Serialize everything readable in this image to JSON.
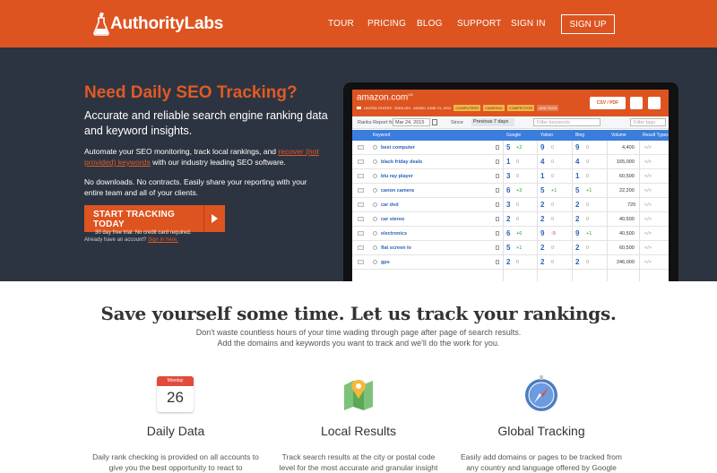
{
  "nav": {
    "logo_text": "AuthorityLabs",
    "links": [
      "TOUR",
      "PRICING",
      "BLOG",
      "SUPPORT",
      "SIGN IN"
    ],
    "signup": "SIGN UP"
  },
  "hero": {
    "title": "Need Daily SEO Tracking?",
    "subtitle": "Accurate and reliable search engine ranking data and keyword insights.",
    "p1_before": "Automate your SEO monitoring, track local rankings, and ",
    "p1_link": "recover (not provided) keywords",
    "p1_after": " with our industry leading SEO software.",
    "p2": "No downloads. No contracts. Easily share your reporting with your entire team and all of your clients.",
    "cta_main": "START TRACKING TODAY",
    "cta_small": "30 day free trial. No credit card required.",
    "already_text": "Already have an account? ",
    "already_link": "Sign in here."
  },
  "app": {
    "domain": "amazon.com",
    "domain_sup": "US",
    "meta": "UNITED STATES · ENGLISH",
    "added": "ADDED JUNE 21, 2012",
    "tags": [
      "COMPUTERS",
      "CAMERAS",
      "COMPETITOR",
      "ADD TAGS"
    ],
    "csv": "CSV / PDF",
    "ranks_label": "Ranks Report for",
    "date": "Mar 24, 2015",
    "since": "Since",
    "since_sel": "Previous 7 days",
    "filter_kw": "Filter keywords",
    "filter_tags": "Filter tags",
    "headers": [
      "Keyword",
      "Google",
      "Yahoo",
      "Bing",
      "Volume",
      "Result Types"
    ],
    "rows": [
      {
        "kw": "best computer",
        "g": "5",
        "gd": "+2",
        "y": "9",
        "yd": "0",
        "b": "9",
        "bd": "0",
        "vol": "4,400"
      },
      {
        "kw": "black friday deals",
        "g": "1",
        "gd": "0",
        "y": "4",
        "yd": "0",
        "b": "4",
        "bd": "0",
        "vol": "165,000"
      },
      {
        "kw": "blu ray player",
        "g": "3",
        "gd": "0",
        "y": "1",
        "yd": "0",
        "b": "1",
        "bd": "0",
        "vol": "60,500"
      },
      {
        "kw": "canon camera",
        "g": "6",
        "gd": "+3",
        "y": "5",
        "yd": "+1",
        "b": "5",
        "bd": "+1",
        "vol": "22,200"
      },
      {
        "kw": "car dvd",
        "g": "3",
        "gd": "0",
        "y": "2",
        "yd": "0",
        "b": "2",
        "bd": "0",
        "vol": "720"
      },
      {
        "kw": "car stereo",
        "g": "2",
        "gd": "0",
        "y": "2",
        "yd": "0",
        "b": "2",
        "bd": "0",
        "vol": "40,500"
      },
      {
        "kw": "electronics",
        "g": "6",
        "gd": "+6",
        "y": "9",
        "yd": "-5",
        "b": "9",
        "bd": "+1",
        "vol": "40,500"
      },
      {
        "kw": "flat screen tv",
        "g": "5",
        "gd": "+1",
        "y": "2",
        "yd": "0",
        "b": "2",
        "bd": "0",
        "vol": "60,500"
      },
      {
        "kw": "gps",
        "g": "2",
        "gd": "0",
        "y": "2",
        "yd": "0",
        "b": "2",
        "bd": "0",
        "vol": "246,000"
      }
    ]
  },
  "section2": {
    "title": "Save yourself some time. Let us track your rankings.",
    "sub1": "Don't waste countless hours of your time wading through page after page of search results.",
    "sub2": "Add the domains and keywords you want to track and we'll do the work for you."
  },
  "features": [
    {
      "title": "Daily Data",
      "desc": "Daily rank checking is provided on all accounts to give you the best opportunity to react to"
    },
    {
      "title": "Local Results",
      "desc": "Track search results at the city or postal code level for the most accurate and granular insight"
    },
    {
      "title": "Global Tracking",
      "desc": "Easily add domains or pages to be tracked from any country and language offered by Google"
    }
  ],
  "calendar": {
    "month": "Monday",
    "day": "26"
  },
  "colors": {
    "brand": "#dd5421",
    "hero_bg": "#2d3441",
    "table_header": "#3b7ddc"
  }
}
